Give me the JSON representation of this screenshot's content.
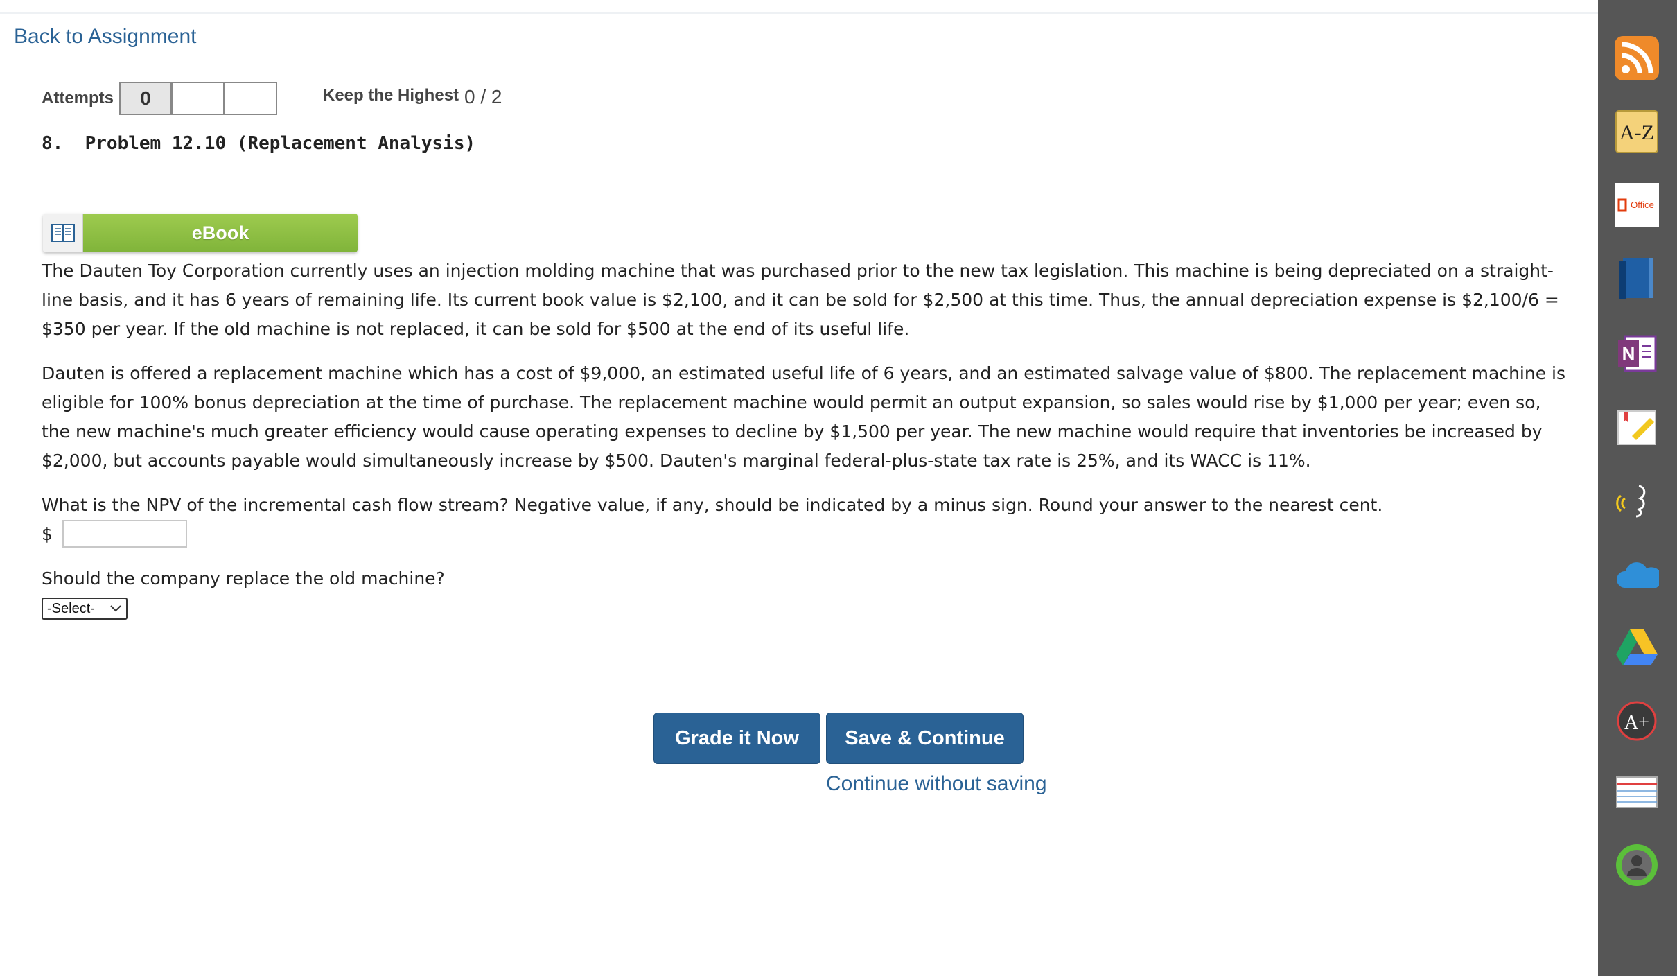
{
  "nav": {
    "back_label": "Back to Assignment"
  },
  "attempts": {
    "label": "Attempts",
    "boxes": [
      "0",
      "",
      ""
    ],
    "keep_label": "Keep the Highest",
    "score": "0 / 2"
  },
  "problem": {
    "title": "8.  Problem 12.10 (Replacement Analysis)",
    "ebook_label": "eBook",
    "paragraphs": [
      "The Dauten Toy Corporation currently uses an injection molding machine that was purchased prior to the new tax legislation. This machine is being depreciated on a straight-line basis, and it has 6 years of remaining life. Its current book value is $2,100, and it can be sold for $2,500 at this time. Thus, the annual depreciation expense is $2,100/6 = $350 per year. If the old machine is not replaced, it can be sold for $500 at the end of its useful life.",
      "Dauten is offered a replacement machine which has a cost of $9,000, an estimated useful life of 6 years, and an estimated salvage value of $800. The replacement machine is eligible for 100% bonus depreciation at the time of purchase. The replacement machine would permit an output expansion, so sales would rise by $1,000 per year; even so, the new machine's much greater efficiency would cause operating expenses to decline by $1,500 per year. The new machine would require that inventories be increased by $2,000, but accounts payable would simultaneously increase by $500. Dauten's marginal federal-plus-state tax rate is 25%, and its WACC is 11%."
    ],
    "question1": "What is the NPV of the incremental cash flow stream? Negative value, if any, should be indicated by a minus sign. Round your answer to the nearest cent.",
    "currency_symbol": "$",
    "npv_value": "",
    "question2": "Should the company replace the old machine?",
    "select_value": "-Select-"
  },
  "actions": {
    "grade_label": "Grade it Now",
    "save_label": "Save & Continue",
    "continue_label": "Continue without saving"
  },
  "sidebar": {
    "az_label": "A-Z",
    "office_label": "Office",
    "onenote_label": "N"
  },
  "colors": {
    "link": "#2a6295",
    "button": "#2a6295",
    "ebook_green": "#8cbf45",
    "sidebar": "#565656"
  }
}
